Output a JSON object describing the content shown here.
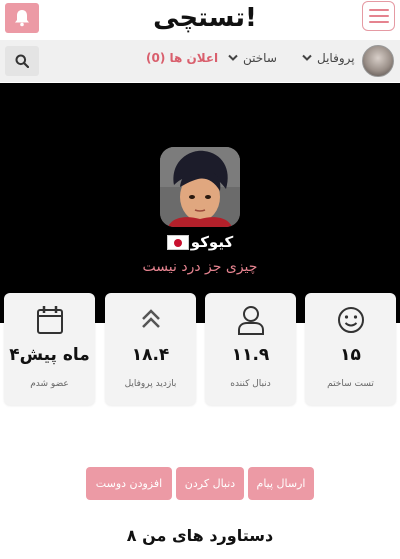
{
  "header": {
    "logo_text": "تستچی!",
    "bell_icon": "bell-icon",
    "menu_icon": "hamburger-icon"
  },
  "nav": {
    "profile_label": "پروفایل",
    "create_label": "ساختن",
    "ads_label": "اعلان ها (0)",
    "search_icon": "search-icon"
  },
  "profile": {
    "username": "کیوکو",
    "bio": "چیزی جز درد نیست"
  },
  "stats": [
    {
      "value": "۱۵",
      "label": "تست ساختم",
      "icon": "smiley-icon"
    },
    {
      "value": "۱۱.۹",
      "label": "دنبال کننده",
      "icon": "user-icon"
    },
    {
      "value": "۱۸.۴",
      "label": "بازدید پروفایل",
      "icon": "chevrons-up-icon"
    },
    {
      "value": "۴ماه پیش",
      "label": "عضو شدم",
      "icon": "calendar-icon"
    }
  ],
  "actions": {
    "send_message": "ارسال پیام",
    "follow": "دنبال کردن",
    "add_friend": "افزودن دوست"
  },
  "achievements_title": "دستاورد های من ۸",
  "colors": {
    "accent": "#ec9aa5",
    "accent_text": "#e5838f",
    "banner": "#000000"
  }
}
